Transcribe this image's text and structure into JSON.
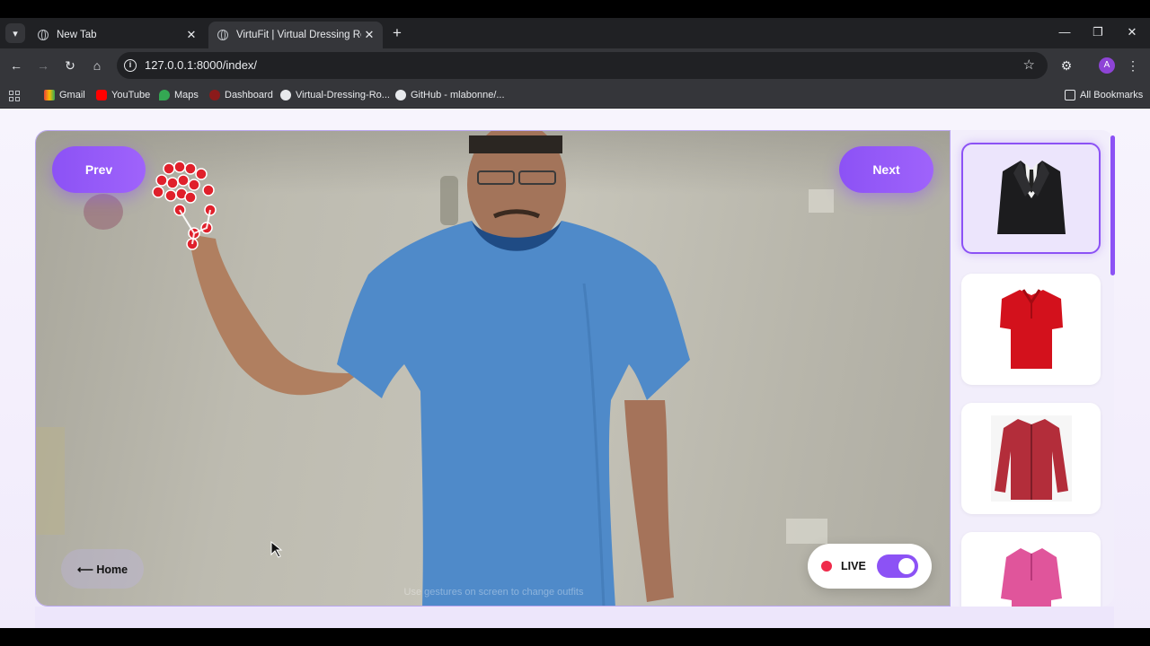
{
  "browser": {
    "tabs": [
      {
        "title": "New Tab",
        "active": false
      },
      {
        "title": "VirtuFit | Virtual Dressing Room",
        "active": true
      }
    ],
    "url": "127.0.0.1:8000/index/",
    "profile_initial": "A",
    "bookmarks": [
      "Gmail",
      "YouTube",
      "Maps",
      "Dashboard",
      "Virtual-Dressing-Ro...",
      "GitHub - mlabonne/..."
    ],
    "all_bookmarks_label": "All Bookmarks"
  },
  "app": {
    "prev_label": "Prev",
    "next_label": "Next",
    "home_label": "⟵ Home",
    "live_label": "LIVE",
    "live_on": true,
    "hint_text": "Use gestures on screen to change outfits",
    "outfits": [
      {
        "name": "black-suit",
        "color": "#1c1c1e",
        "selected": true
      },
      {
        "name": "red-polo",
        "color": "#d3111c",
        "selected": false
      },
      {
        "name": "maroon-shirt",
        "color": "#b32d3a",
        "selected": false
      },
      {
        "name": "pink-kurta",
        "color": "#e0559b",
        "selected": false
      }
    ]
  },
  "colors": {
    "accent": "#8c52f5",
    "live_dot": "#ef2b4b",
    "tshirt": "#4f8ac9"
  }
}
